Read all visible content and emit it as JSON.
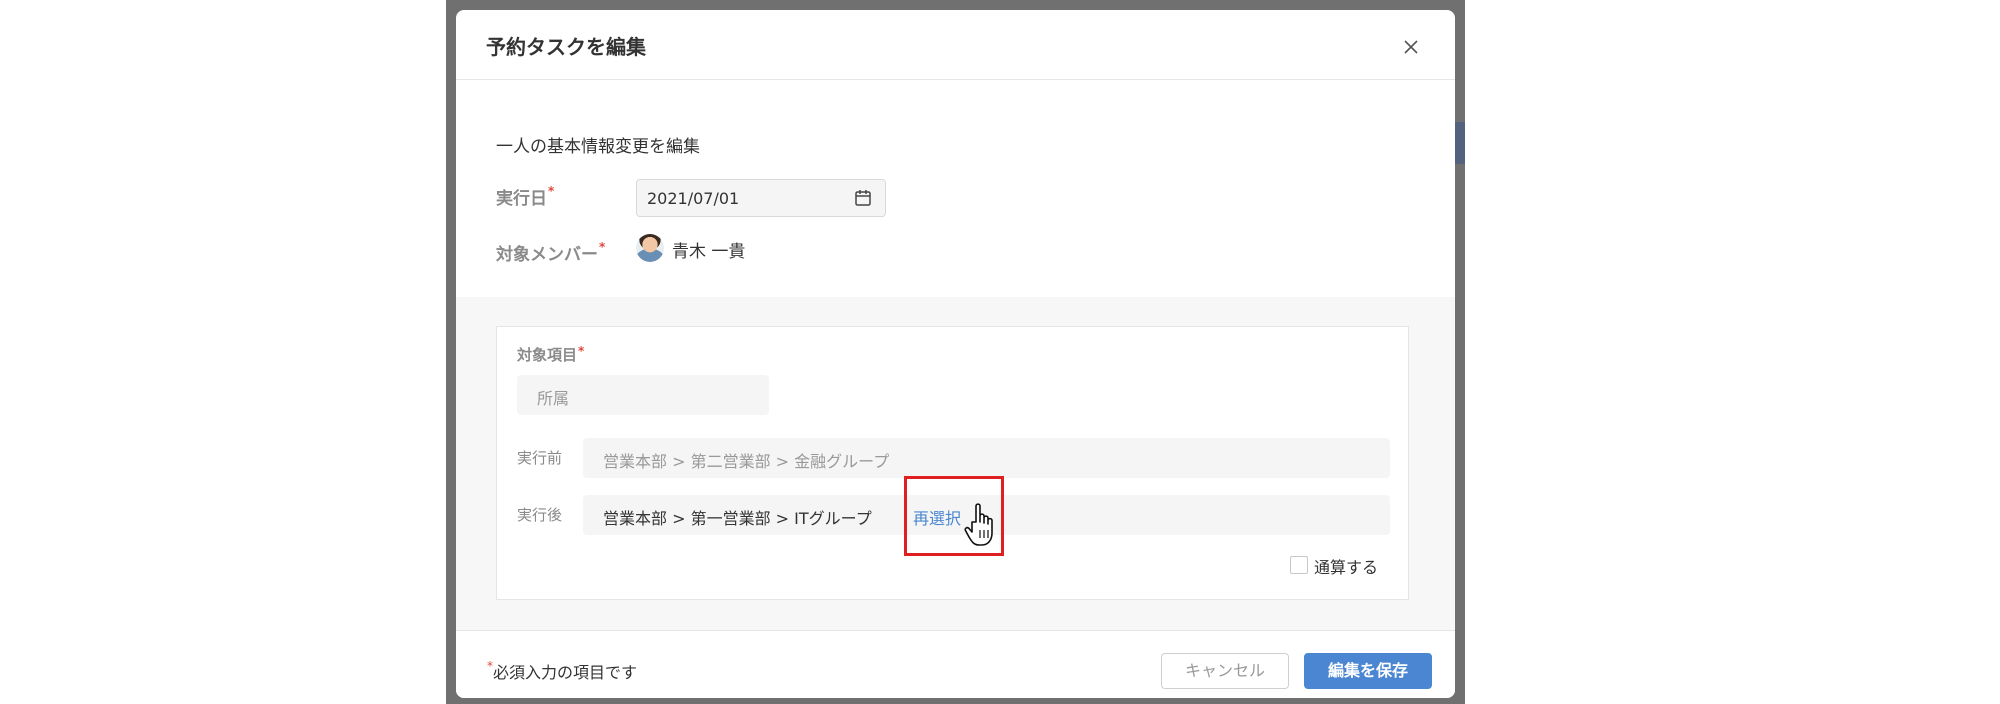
{
  "modal": {
    "title": "予約タスクを編集",
    "task_description": "一人の基本情報変更を編集",
    "fields": {
      "execution_date_label": "実行日",
      "execution_date_value": "2021/07/01",
      "target_member_label": "対象メンバー",
      "target_member_name": "青木 一貴"
    },
    "panel": {
      "target_item_label": "対象項目",
      "target_item_value": "所属",
      "before_label": "実行前",
      "before_value": "営業本部 > 第二営業部 > 金融グループ",
      "after_label": "実行後",
      "after_value": "営業本部 > 第一営業部 > ITグループ",
      "reselect_label": "再選択",
      "checkbox_label": "通算する",
      "checkbox_checked": false
    },
    "footer": {
      "required_note": "必須入力の項目です",
      "cancel_label": "キャンセル",
      "save_label": "編集を保存"
    },
    "required_mark": "*"
  },
  "colors": {
    "accent": "#4a86d1",
    "required": "#e0483a",
    "highlight": "#e02020"
  }
}
